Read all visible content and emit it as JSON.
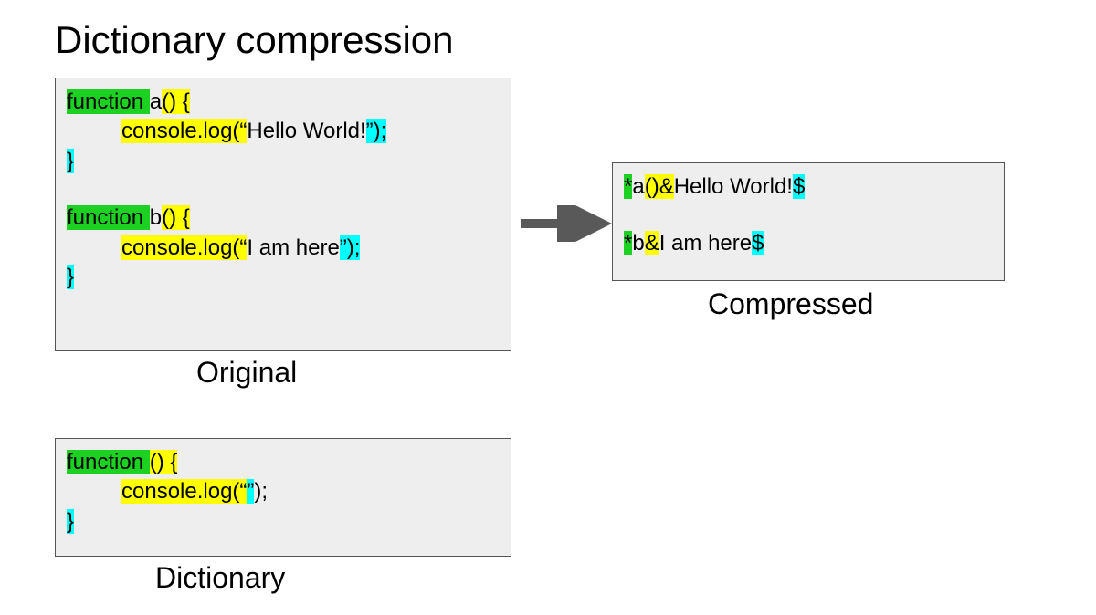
{
  "title": "Dictionary compression",
  "labels": {
    "original": "Original",
    "dictionary": "Dictionary",
    "compressed": "Compressed"
  },
  "original": {
    "fn_a": {
      "kw": "function ",
      "name": "a",
      "sig": "() {",
      "call": "console.log(“",
      "payload": "Hello World!",
      "end": "”);",
      "close": "}"
    },
    "fn_b": {
      "kw": "function ",
      "name": "b",
      "sig": "() {",
      "call": "console.log(“",
      "payload": "I am here",
      "end": "”);",
      "close": "}"
    }
  },
  "dictionary": {
    "kw": "function ",
    "sig": "() {",
    "call": "console.log(“",
    "quot": "”",
    "end": ");",
    "close": "}"
  },
  "compressed": {
    "line1": {
      "star": "*",
      "name": "a",
      "sig": "()",
      "amp": "&",
      "payload": "Hello World!",
      "dollar": "$"
    },
    "line2": {
      "star": "*",
      "name": "b",
      "amp": "&",
      "payload": "I am here",
      "dollar": "$"
    }
  },
  "colors": {
    "green": "#1dd123",
    "yellow": "#ffff00",
    "cyan": "#00ffff",
    "boxbg": "#eeeeee",
    "arrow": "#595959"
  }
}
